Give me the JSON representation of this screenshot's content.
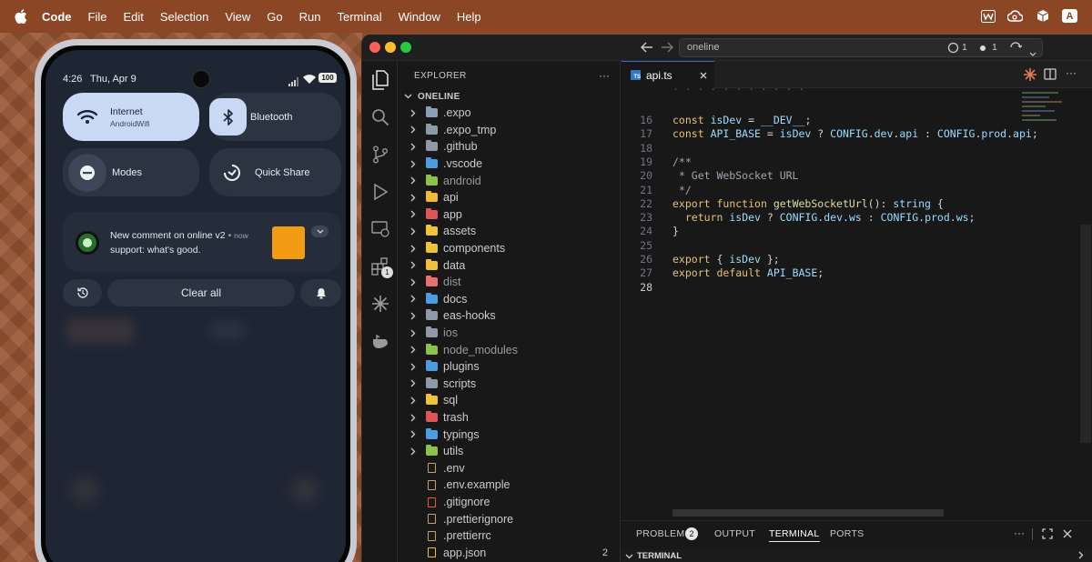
{
  "menubar": {
    "app_name": "Code",
    "items": [
      "File",
      "Edit",
      "Selection",
      "View",
      "Go",
      "Run",
      "Terminal",
      "Window",
      "Help"
    ],
    "tray_icons": [
      "w-app-icon",
      "creative-cloud-icon",
      "shield-box-icon",
      "text-input-icon"
    ],
    "text_input_label": "A"
  },
  "phone": {
    "status": {
      "time": "4:26",
      "date": "Thu, Apr 9",
      "battery": "100"
    },
    "tiles": {
      "internet": {
        "title": "Internet",
        "subtitle": "AndroidWifi"
      },
      "bluetooth": {
        "title": "Bluetooth"
      },
      "modes": {
        "title": "Modes"
      },
      "quick_share": {
        "title": "Quick Share"
      }
    },
    "notification": {
      "title": "New comment on online v2",
      "time": "now",
      "body": "support: what's good.",
      "accent": "#f29b13"
    },
    "clear_all": "Clear all"
  },
  "vscode": {
    "search_value": "oneline",
    "title_counts": {
      "sync": "1",
      "dot": "1"
    },
    "explorer_title": "EXPLORER",
    "root": "ONELINE",
    "activity_badge": "1",
    "tree": [
      {
        "name": ".expo",
        "type": "folder",
        "color": "#8aa0b8",
        "badge_color": "#4a7fd3"
      },
      {
        "name": ".expo_tmp",
        "type": "folder",
        "color": "#8e9aa8"
      },
      {
        "name": ".github",
        "type": "folder",
        "color": "#8e9aa8",
        "badge_color": "#cccccc"
      },
      {
        "name": ".vscode",
        "type": "folder",
        "color": "#4d9be0"
      },
      {
        "name": "android",
        "type": "folder",
        "color": "#8bc34a",
        "dim": true
      },
      {
        "name": "api",
        "type": "folder",
        "color": "#f0b93a"
      },
      {
        "name": "app",
        "type": "folder",
        "color": "#e05555"
      },
      {
        "name": "assets",
        "type": "folder",
        "color": "#f0c23a"
      },
      {
        "name": "components",
        "type": "folder",
        "color": "#f0c23a"
      },
      {
        "name": "data",
        "type": "folder",
        "color": "#f0c23a"
      },
      {
        "name": "dist",
        "type": "folder",
        "color": "#e87070",
        "dim": true
      },
      {
        "name": "docs",
        "type": "folder",
        "color": "#4d9be0"
      },
      {
        "name": "eas-hooks",
        "type": "folder",
        "color": "#8e9aa8"
      },
      {
        "name": "ios",
        "type": "folder",
        "color": "#8e9aa8",
        "dim": true
      },
      {
        "name": "node_modules",
        "type": "folder",
        "color": "#8bc34a",
        "dim": true
      },
      {
        "name": "plugins",
        "type": "folder",
        "color": "#4d9be0"
      },
      {
        "name": "scripts",
        "type": "folder",
        "color": "#8e9aa8"
      },
      {
        "name": "sql",
        "type": "folder",
        "color": "#f0c23a"
      },
      {
        "name": "trash",
        "type": "folder",
        "color": "#e05555"
      },
      {
        "name": "typings",
        "type": "folder",
        "color": "#4d9be0"
      },
      {
        "name": "utils",
        "type": "folder",
        "color": "#8bc34a"
      },
      {
        "name": ".env",
        "type": "file",
        "color": "#c8a070"
      },
      {
        "name": ".env.example",
        "type": "file",
        "color": "#c8a070"
      },
      {
        "name": ".gitignore",
        "type": "file",
        "color": "#e05d44"
      },
      {
        "name": ".prettierignore",
        "type": "file",
        "color": "#c8a070"
      },
      {
        "name": ".prettierrc",
        "type": "file",
        "color": "#c8a070"
      },
      {
        "name": "app.json",
        "type": "file",
        "color": "#f0c23a",
        "count": "2"
      }
    ],
    "tab": {
      "filename": "api.ts",
      "lang": "TS"
    },
    "code_lines": [
      {
        "n": "16",
        "t": "const isDev = __DEV__;"
      },
      {
        "n": "17",
        "t": "const API_BASE = isDev ? CONFIG.dev.api : CONFIG.prod.api;"
      },
      {
        "n": "18",
        "t": ""
      },
      {
        "n": "19",
        "t": "/**"
      },
      {
        "n": "20",
        "t": " * Get WebSocket URL"
      },
      {
        "n": "21",
        "t": " */"
      },
      {
        "n": "22",
        "t": "export function getWebSocketUrl(): string {"
      },
      {
        "n": "23",
        "t": "  return isDev ? CONFIG.dev.ws : CONFIG.prod.ws;"
      },
      {
        "n": "24",
        "t": "}"
      },
      {
        "n": "25",
        "t": ""
      },
      {
        "n": "26",
        "t": "export { isDev };"
      },
      {
        "n": "27",
        "t": "export default API_BASE;"
      },
      {
        "n": "28",
        "t": ""
      }
    ],
    "panel": {
      "tabs": [
        "PROBLEMS",
        "OUTPUT",
        "TERMINAL",
        "PORTS"
      ],
      "problems_count": "2",
      "active_tab": "TERMINAL",
      "section_title": "TERMINAL"
    }
  }
}
